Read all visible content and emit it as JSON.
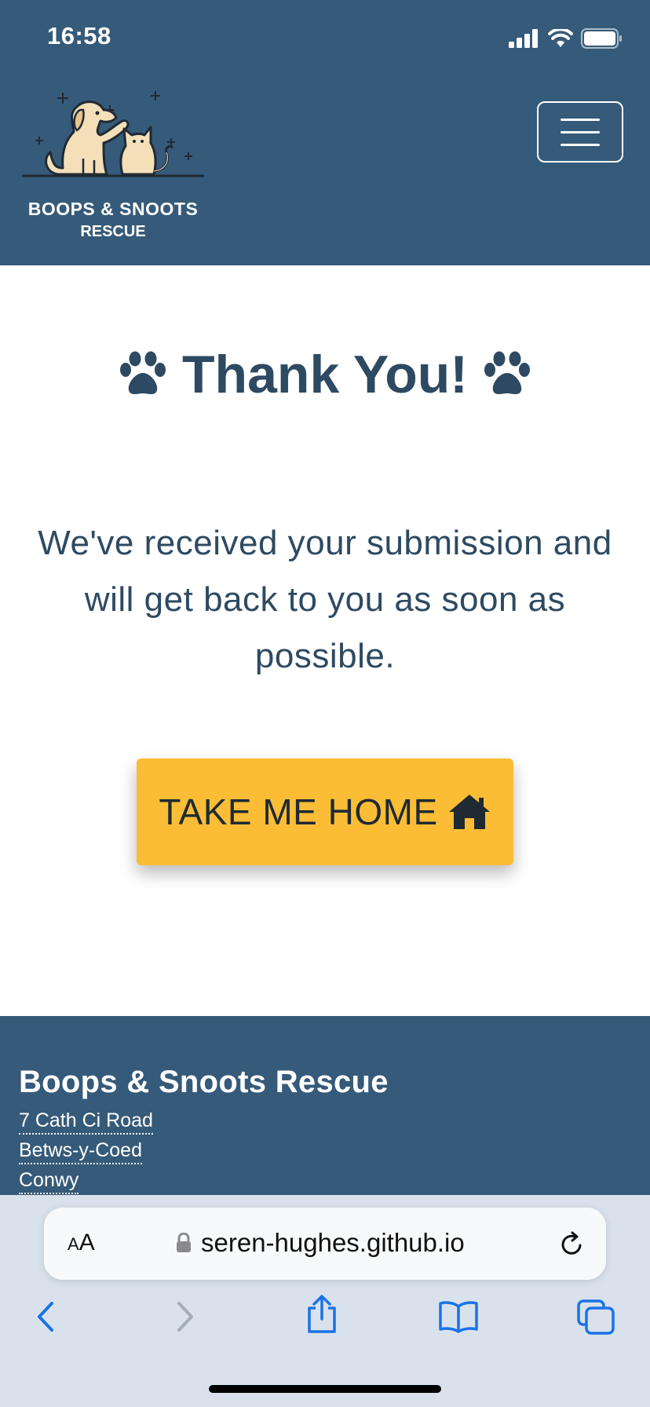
{
  "status_bar": {
    "time": "16:58",
    "icons": [
      "signal-icon",
      "wifi-icon",
      "battery-icon"
    ]
  },
  "header": {
    "logo_line1": "BOOPS & SNOOTS",
    "logo_line2": "RESCUE",
    "menu_icon": "hamburger-icon"
  },
  "main": {
    "title": "Thank You!",
    "message": "We've received your submission and will get back to you as soon as possible.",
    "button_label": "TAKE ME HOME",
    "button_icon": "house-icon"
  },
  "footer": {
    "title": "Boops & Snoots Rescue",
    "address": [
      "7 Cath Ci Road",
      "Betws-y-Coed",
      "Conwy"
    ]
  },
  "browser": {
    "text_size_small": "A",
    "text_size_big": "A",
    "url": "seren-hughes.github.io",
    "toolbar_icons": [
      "back-icon",
      "forward-icon",
      "share-icon",
      "bookmarks-icon",
      "tabs-icon"
    ]
  },
  "colors": {
    "header_bg": "#365a79",
    "title_text": "#2d4a62",
    "button_bg": "#fbbd35",
    "browser_bg": "#d9e2ec",
    "link_blue": "#1a73e8"
  }
}
